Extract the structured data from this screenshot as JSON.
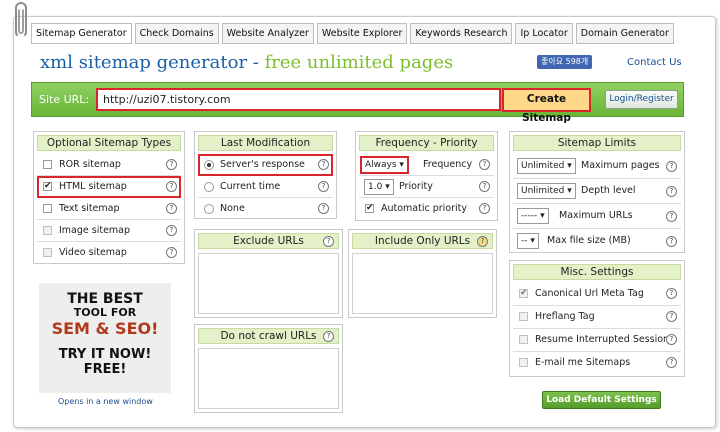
{
  "tabs": [
    "Sitemap Generator",
    "Check Domains",
    "Website Analyzer",
    "Website Explorer",
    "Keywords Research",
    "Ip Locator",
    "Domain Generator"
  ],
  "title": {
    "main": "xml sitemap generator",
    "dash": " - ",
    "free": "free unlimited pages"
  },
  "like_label": "좋아요 598개",
  "contact_label": "Contact Us",
  "site": {
    "label": "Site URL:",
    "value": "http://uzi07.tistory.com",
    "create_label": "Create Sitemap",
    "login_label": "Login/Register"
  },
  "optional": {
    "title": "Optional Sitemap Types",
    "items": [
      {
        "label": "ROR sitemap",
        "checked": false
      },
      {
        "label": "HTML sitemap",
        "checked": true
      },
      {
        "label": "Text sitemap",
        "checked": false
      },
      {
        "label": "Image sitemap",
        "checked": false
      },
      {
        "label": "Video sitemap",
        "checked": false
      }
    ]
  },
  "lastmod": {
    "title": "Last Modification",
    "items": [
      {
        "label": "Server's response",
        "selected": true
      },
      {
        "label": "Current time",
        "selected": false
      },
      {
        "label": "None",
        "selected": false
      }
    ]
  },
  "freq": {
    "title": "Frequency - Priority",
    "frequency_value": "Always",
    "frequency_label": "Frequency",
    "priority_value": "1.0",
    "priority_label": "Priority",
    "auto_label": "Automatic priority",
    "auto_checked": true
  },
  "limits": {
    "title": "Sitemap Limits",
    "items": [
      {
        "value": "Unlimited",
        "label": "Maximum pages"
      },
      {
        "value": "Unlimited",
        "label": "Depth level"
      },
      {
        "value": "-----",
        "label": "Maximum URLs"
      },
      {
        "value": "--",
        "label": "Max file size (MB)"
      }
    ]
  },
  "exclude": {
    "title": "Exclude URLs"
  },
  "include": {
    "title": "Include Only URLs"
  },
  "nocrawl": {
    "title": "Do not crawl URLs"
  },
  "misc": {
    "title": "Misc. Settings",
    "items": [
      {
        "label": "Canonical Url Meta Tag",
        "checked": true
      },
      {
        "label": "Hreflang Tag",
        "checked": false
      },
      {
        "label": "Resume Interrupted Session",
        "checked": false
      },
      {
        "label": "E-mail me Sitemaps",
        "checked": false
      }
    ]
  },
  "load_default_label": "Load Default Settings",
  "ad": {
    "l1": "THE BEST",
    "l2": "TOOL FOR",
    "l3": "SEM & SEO!",
    "l4": "TRY IT NOW!",
    "l5": "FREE!",
    "note": "Opens in a new window"
  },
  "help_glyph": "?",
  "check_glyph": "✔"
}
